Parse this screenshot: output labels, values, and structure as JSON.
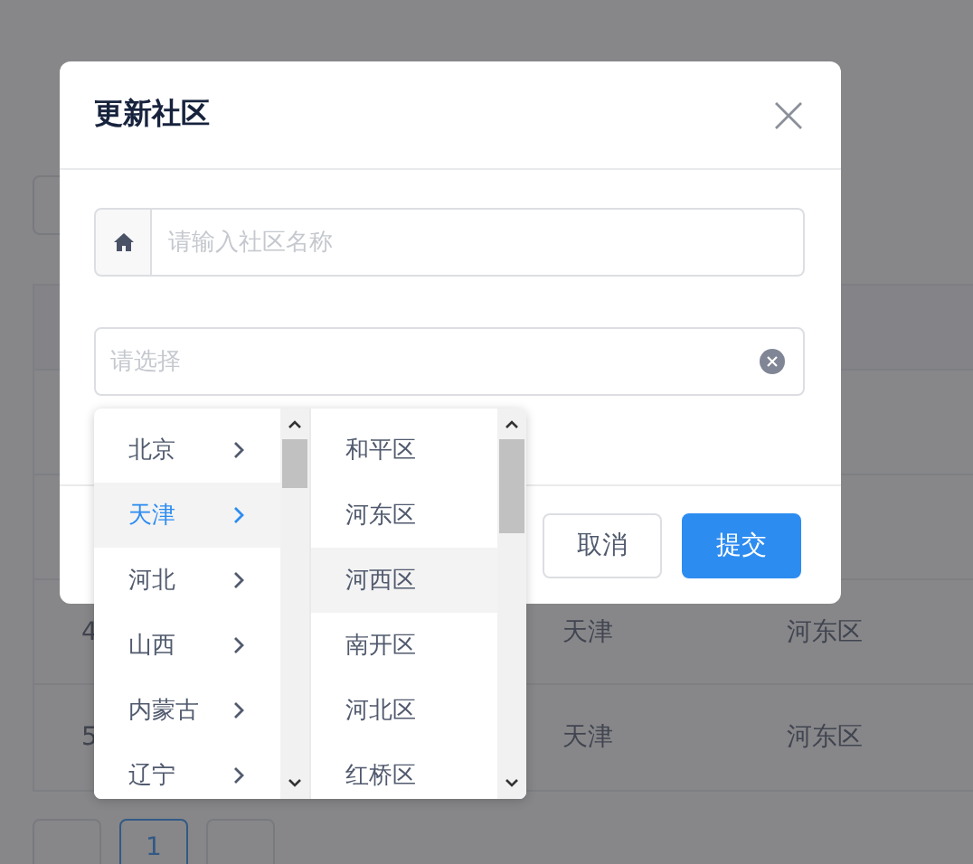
{
  "table": {
    "rows": [
      {},
      {},
      {
        "column_1": "4",
        "column_2": "天津",
        "column_3": "河东区"
      },
      {
        "column_1": "5",
        "column_2": "天津",
        "column_3": "河东区"
      }
    ]
  },
  "pagination": {
    "pages": [
      {
        "label": "1",
        "selected": true
      }
    ]
  },
  "dialog": {
    "title": "更新社区",
    "name_field": {
      "placeholder": "请输入社区名称"
    },
    "region_select": {
      "placeholder": "请选择"
    },
    "buttons": [
      {
        "label": "取消",
        "kind": "default"
      },
      {
        "label": "提交",
        "kind": "primary"
      }
    ]
  },
  "cascader": {
    "columns": [
      {
        "items": [
          {
            "label": "北京",
            "selected": false,
            "has_children": true
          },
          {
            "label": "天津",
            "selected": true,
            "has_children": true
          },
          {
            "label": "河北",
            "selected": false,
            "has_children": true
          },
          {
            "label": "山西",
            "selected": false,
            "has_children": true
          },
          {
            "label": "内蒙古",
            "selected": false,
            "has_children": true
          },
          {
            "label": "辽宁",
            "selected": false,
            "has_children": true
          }
        ]
      },
      {
        "items": [
          {
            "label": "和平区",
            "selected": false,
            "has_children": false
          },
          {
            "label": "河东区",
            "selected": false,
            "has_children": false
          },
          {
            "label": "河西区",
            "selected": false,
            "hovered": true,
            "has_children": false
          },
          {
            "label": "南开区",
            "selected": false,
            "has_children": false
          },
          {
            "label": "河北区",
            "selected": false,
            "has_children": false
          },
          {
            "label": "红桥区",
            "selected": false,
            "has_children": false
          }
        ]
      }
    ]
  }
}
